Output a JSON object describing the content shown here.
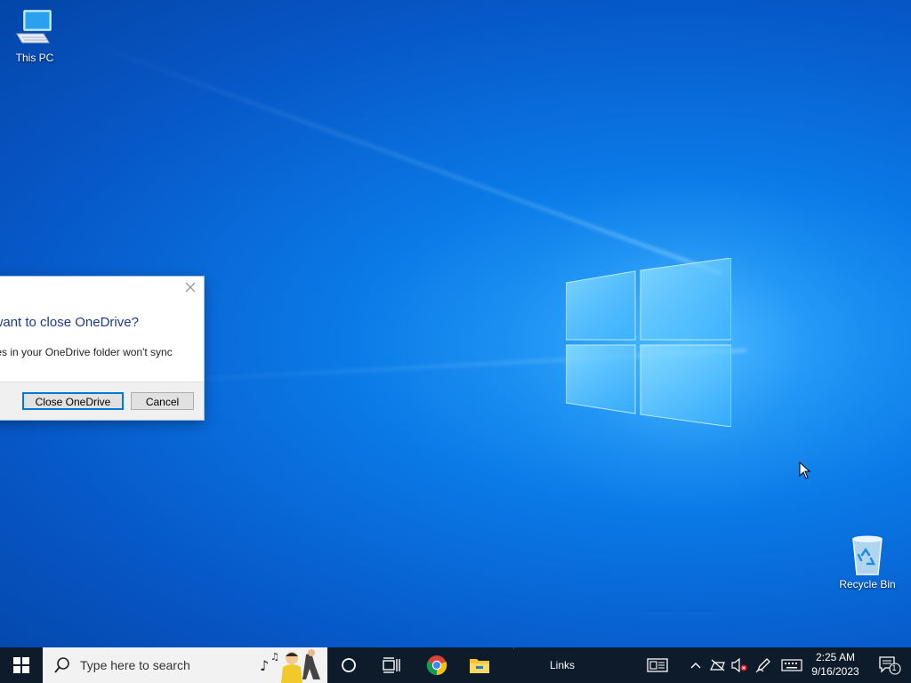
{
  "desktop": {
    "icons": [
      {
        "label": "This PC",
        "icon": "computer-icon"
      },
      {
        "label": "Recycle Bin",
        "icon": "recycle-bin-icon"
      }
    ]
  },
  "dialog": {
    "heading": "u want to close OneDrive?",
    "body": ", files in your OneDrive folder won't sync",
    "body_line2": ".",
    "primary_button": "Close OneDrive",
    "cancel_button": "Cancel",
    "close_icon": "close-icon"
  },
  "taskbar": {
    "search_placeholder": "Type here to search",
    "links_label": "Links",
    "time": "2:25 AM",
    "date": "9/16/2023",
    "notification_count": "1",
    "accent_color": "#0e1b2b",
    "icons": [
      "windows-start-icon",
      "search-icon",
      "cortana-icon",
      "task-view-icon",
      "chrome-icon",
      "file-explorer-icon",
      "news-icon",
      "chevron-up-icon",
      "network-icon",
      "volume-muted-icon",
      "pen-icon",
      "keyboard-icon",
      "notification-icon"
    ]
  }
}
